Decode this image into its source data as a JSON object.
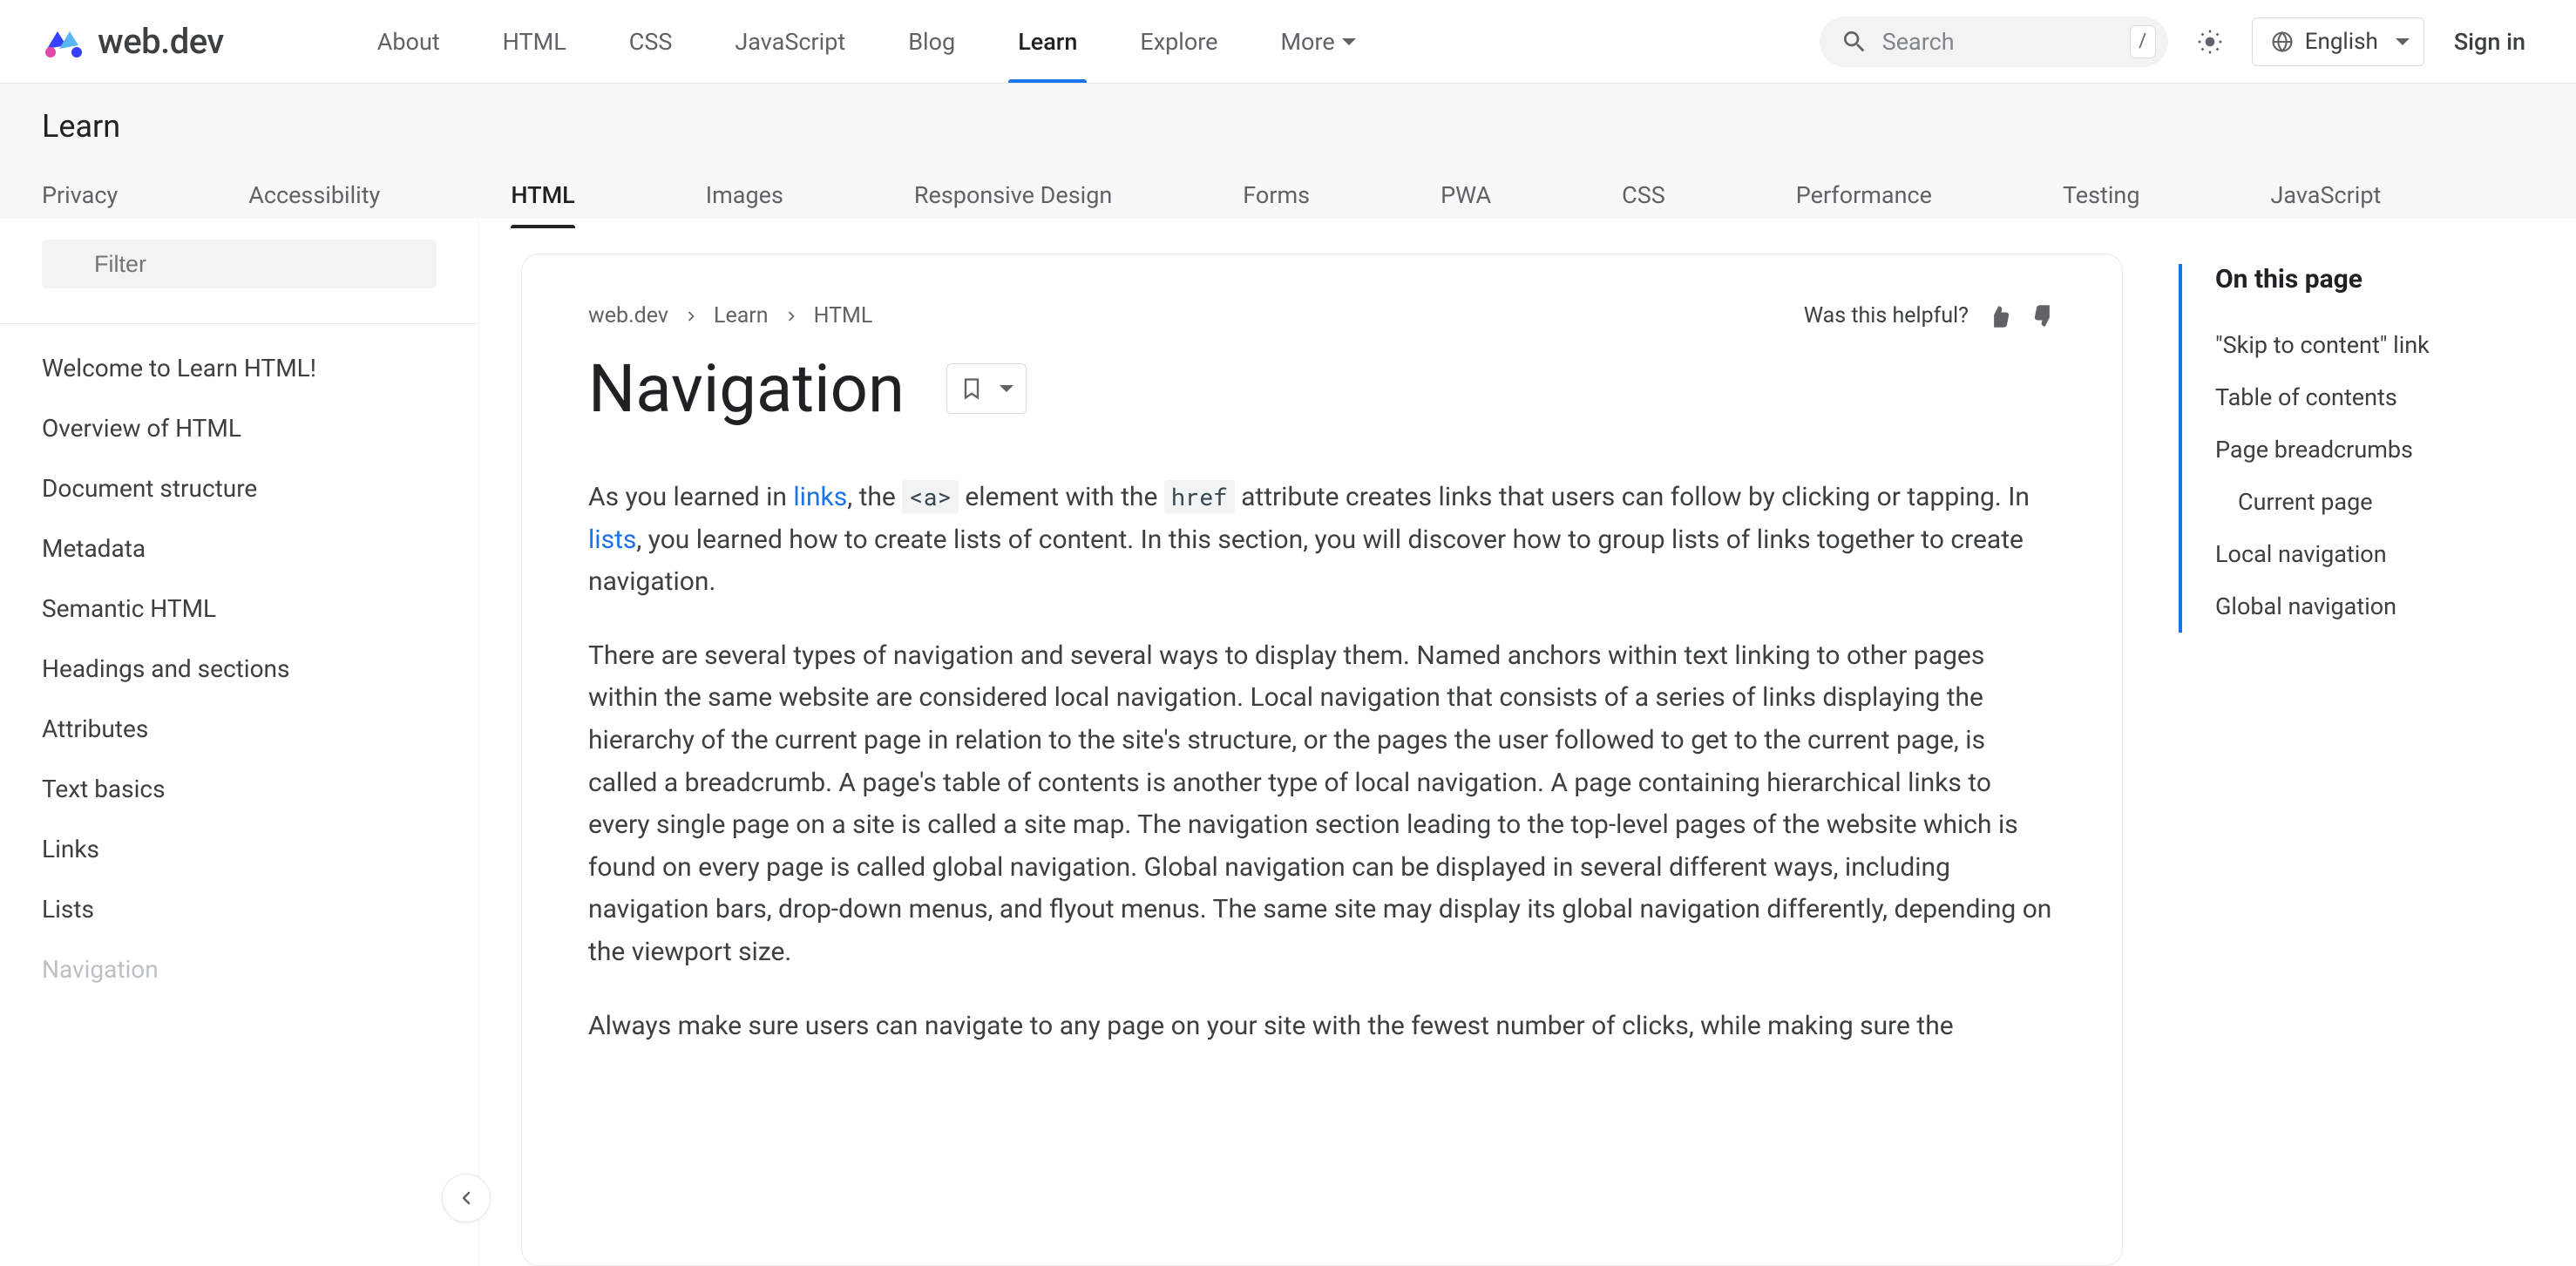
{
  "brand": "web.dev",
  "topnav": {
    "items": [
      "About",
      "HTML",
      "CSS",
      "JavaScript",
      "Blog",
      "Learn",
      "Explore",
      "More"
    ],
    "active_index": 5
  },
  "search": {
    "placeholder": "Search",
    "shortcut": "/"
  },
  "language": "English",
  "signin": "Sign in",
  "subheader": {
    "title": "Learn",
    "tabs": [
      "Privacy",
      "Accessibility",
      "HTML",
      "Images",
      "Responsive Design",
      "Forms",
      "PWA",
      "CSS",
      "Performance",
      "Testing",
      "JavaScript"
    ],
    "active_index": 2
  },
  "sidebar": {
    "filter_placeholder": "Filter",
    "items": [
      "Welcome to Learn HTML!",
      "Overview of HTML",
      "Document structure",
      "Metadata",
      "Semantic HTML",
      "Headings and sections",
      "Attributes",
      "Text basics",
      "Links",
      "Lists",
      "Navigation"
    ]
  },
  "breadcrumb": [
    "web.dev",
    "Learn",
    "HTML"
  ],
  "helpful_text": "Was this helpful?",
  "page_title": "Navigation",
  "content": {
    "p1_a": "As you learned in ",
    "p1_link1": "links",
    "p1_b": ", the ",
    "p1_code1": "<a>",
    "p1_c": " element with the ",
    "p1_code2": "href",
    "p1_d": " attribute creates links that users can follow by clicking or tapping. In ",
    "p1_link2": "lists",
    "p1_e": ", you learned how to create lists of content. In this section, you will discover how to group lists of links together to create navigation.",
    "p2": "There are several types of navigation and several ways to display them. Named anchors within text linking to other pages within the same website are considered local navigation. Local navigation that consists of a series of links displaying the hierarchy of the current page in relation to the site's structure, or the pages the user followed to get to the current page, is called a breadcrumb. A page's table of contents is another type of local navigation. A page containing hierarchical links to every single page on a site is called a site map. The navigation section leading to the top-level pages of the website which is found on every page is called global navigation. Global navigation can be displayed in several different ways, including navigation bars, drop-down menus, and flyout menus. The same site may display its global navigation differently, depending on the viewport size.",
    "p3": "Always make sure users can navigate to any page on your site with the fewest number of clicks, while making sure the"
  },
  "toc": {
    "title": "On this page",
    "items": [
      {
        "label": "\"Skip to content\" link",
        "indent": false
      },
      {
        "label": "Table of contents",
        "indent": false
      },
      {
        "label": "Page breadcrumbs",
        "indent": false
      },
      {
        "label": "Current page",
        "indent": true
      },
      {
        "label": "Local navigation",
        "indent": false
      },
      {
        "label": "Global navigation",
        "indent": false
      }
    ]
  }
}
